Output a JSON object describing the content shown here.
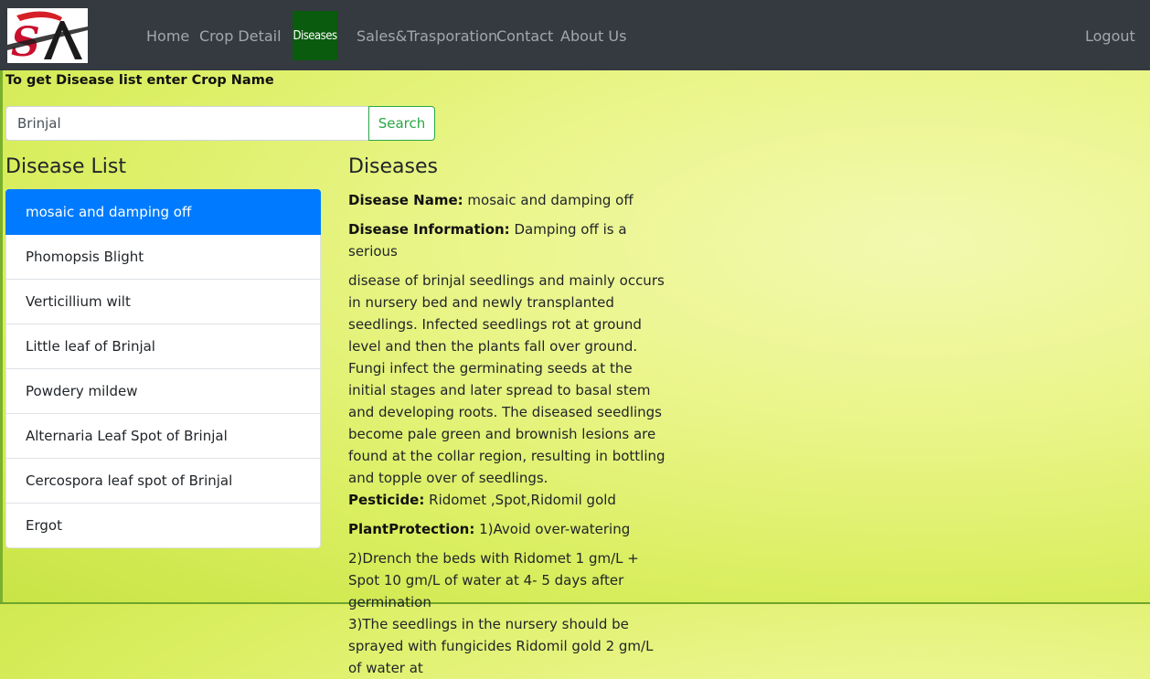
{
  "nav": {
    "items": [
      "Home",
      "Crop Detail",
      "Diseases",
      "Sales&Trasporation",
      "Contact",
      "About Us"
    ],
    "active": "Diseases",
    "logout": "Logout"
  },
  "logo": {
    "text": "SA"
  },
  "search": {
    "instruction": "To get Disease list enter Crop Name",
    "value": "Brinjal",
    "button": "Search"
  },
  "list": {
    "title": "Disease List",
    "items": [
      "mosaic and damping off",
      "Phomopsis Blight",
      "Verticillium wilt",
      "Little leaf of Brinjal",
      "Powdery mildew",
      "Alternaria Leaf Spot of Brinjal",
      "Cercospora leaf spot of Brinjal",
      "Ergot"
    ],
    "active_index": 0
  },
  "details": {
    "title": "Diseases",
    "name_label": "Disease Name:",
    "name": "mosaic and damping off",
    "info_label": "Disease Information:",
    "info_first": "Damping off is a serious",
    "info_rest": "disease of brinjal seedlings and mainly occurs in nursery bed and newly transplanted seedlings. Infected seedlings rot at ground level and then the plants fall over ground. Fungi infect the germinating seeds at the initial stages and later spread to basal stem and developing roots. The diseased seedlings become pale green and brownish lesions are found at the collar region, resulting in bottling and topple over of seedlings.",
    "pesticide_label": "Pesticide:",
    "pesticide": "Ridomet ,Spot,Ridomil gold",
    "protection_label": "PlantProtection:",
    "protection_first": "1)Avoid over-watering",
    "protection_rest": "2)Drench the beds with Ridomet 1 gm/L + Spot 10 gm/L of water at 4- 5 days after germination",
    "protection_more": "3)The seedlings in the nursery should be sprayed with fungicides Ridomil gold 2 gm/L of water at"
  },
  "colors": {
    "navbar": "#343a40",
    "active_nav": "#0b5b0e",
    "active_item": "#007bff",
    "search_btn": "#28a745"
  }
}
